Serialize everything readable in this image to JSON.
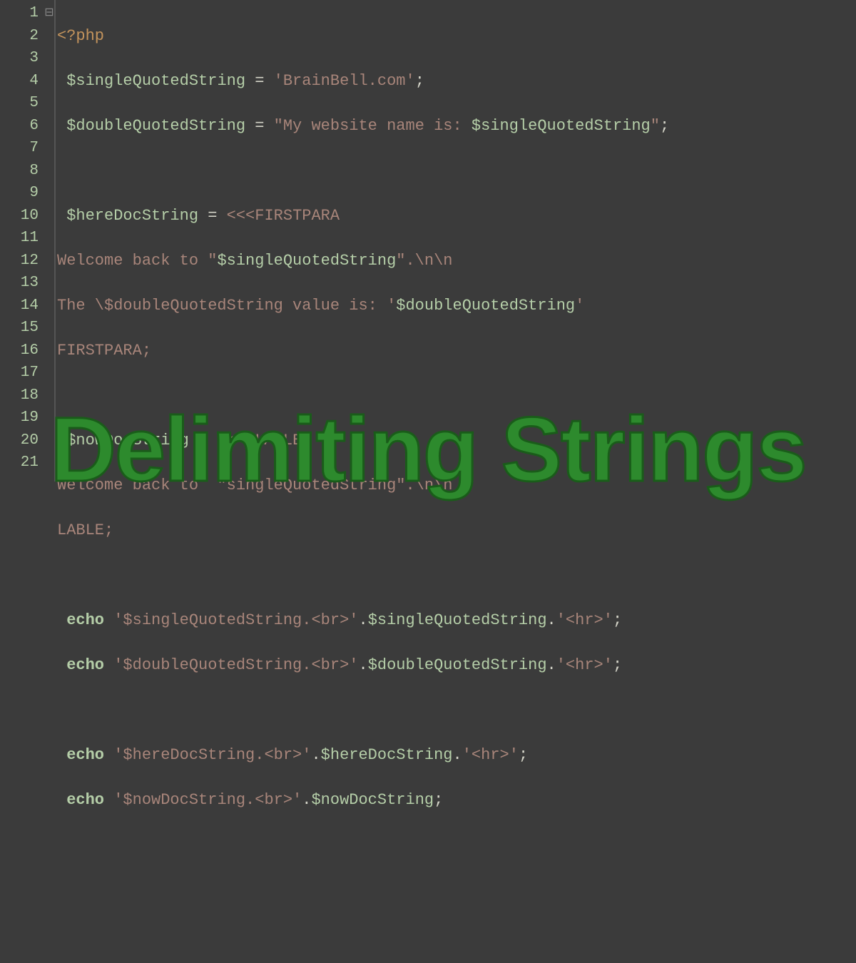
{
  "lineNumbers": [
    "1",
    "2",
    "3",
    "4",
    "5",
    "6",
    "7",
    "8",
    "9",
    "10",
    "11",
    "12",
    "13",
    "14",
    "15",
    "16",
    "17",
    "18",
    "19",
    "20",
    "21"
  ],
  "foldMark": "⊟",
  "code": {
    "l1_open": "<?php",
    "l2_var": "$singleQuotedString",
    "l2_eq": " = ",
    "l2_str": "'BrainBell.com'",
    "l2_semi": ";",
    "l3_var": "$doubleQuotedString",
    "l3_eq": " = ",
    "l3_str1": "\"My website name is: ",
    "l3_interp": "$singleQuotedString",
    "l3_str2": "\"",
    "l3_semi": ";",
    "l5_var": "$hereDocString",
    "l5_eq": " = ",
    "l5_here": "<<<FIRSTPARA",
    "l6_txt1": "Welcome back to \"",
    "l6_interp": "$singleQuotedString",
    "l6_txt2": "\".\\n\\n",
    "l7_txt1": "The \\$doubleQuotedString value is: '",
    "l7_interp": "$doubleQuotedString",
    "l7_txt2": "'",
    "l8_end": "FIRSTPARA;",
    "l10_var": "$nowDocString",
    "l10_eq": " = ",
    "l10_here": "<<<'LABLE'",
    "l11_txt": "Welcome back to  \"singleQuotedString\".\\n\\n",
    "l12_end": "LABLE;",
    "l14_echo": "echo",
    "l14_sp": " ",
    "l14_str1": "'$singleQuotedString.<br>'",
    "l14_dot1": ".",
    "l14_var": "$singleQuotedString",
    "l14_dot2": ".",
    "l14_str2": "'<hr>'",
    "l14_semi": ";",
    "l15_echo": "echo",
    "l15_sp": " ",
    "l15_str1": "'$doubleQuotedString.<br>'",
    "l15_dot1": ".",
    "l15_var": "$doubleQuotedString",
    "l15_dot2": ".",
    "l15_str2": "'<hr>'",
    "l15_semi": ";",
    "l17_echo": "echo",
    "l17_sp": " ",
    "l17_str1": "'$hereDocString.<br>'",
    "l17_dot1": ".",
    "l17_var": "$hereDocString",
    "l17_dot2": ".",
    "l17_str2": "'<hr>'",
    "l17_semi": ";",
    "l18_echo": "echo",
    "l18_sp": " ",
    "l18_str1": "'$nowDocString.<br>'",
    "l18_dot1": ".",
    "l18_var": "$nowDocString",
    "l18_semi": ";"
  },
  "overlay": "Delimiting Strings"
}
